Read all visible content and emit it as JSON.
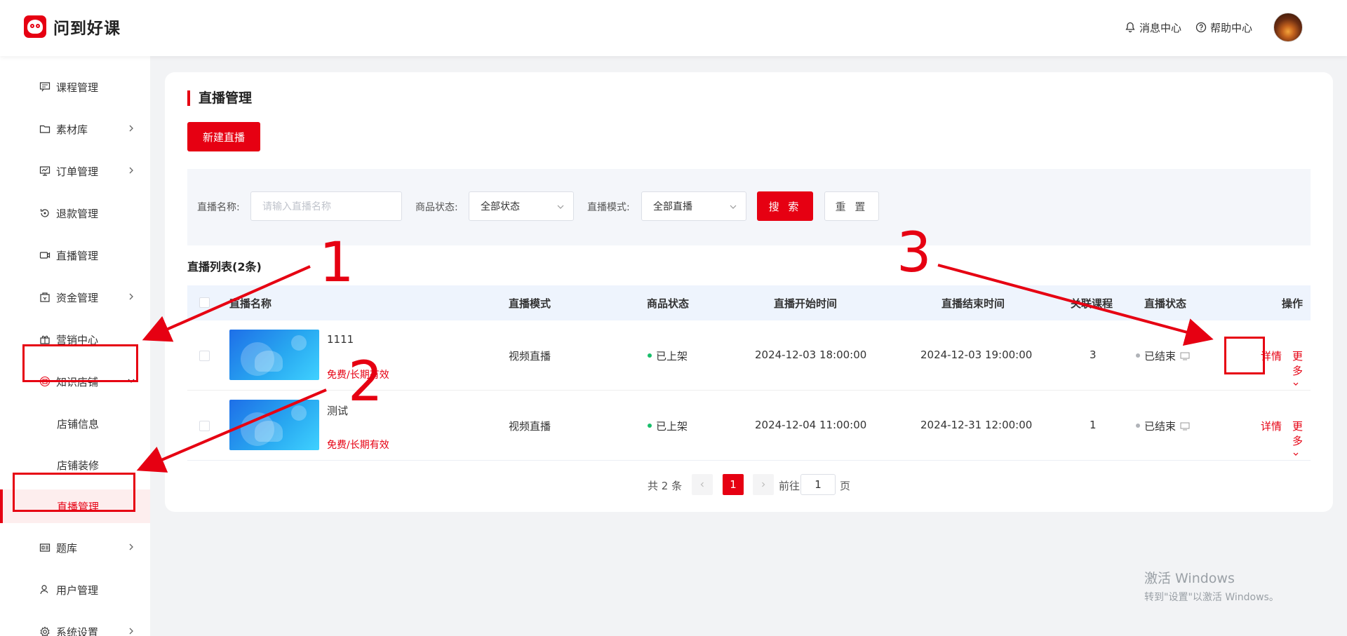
{
  "header": {
    "brand": "问到好课",
    "message_center": "消息中心",
    "help_center": "帮助中心"
  },
  "sidebar": {
    "items": [
      {
        "label": "课程管理",
        "icon": "chat-icon"
      },
      {
        "label": "素材库",
        "icon": "folder-icon"
      },
      {
        "label": "订单管理",
        "icon": "monitor-icon"
      },
      {
        "label": "退款管理",
        "icon": "refund-icon"
      },
      {
        "label": "直播管理",
        "icon": "video-icon"
      },
      {
        "label": "资金管理",
        "icon": "wallet-icon"
      },
      {
        "label": "营销中心",
        "icon": "gift-icon"
      },
      {
        "label": "知识店铺",
        "icon": "shop-icon"
      },
      {
        "label": "题库",
        "icon": "question-bank-icon"
      },
      {
        "label": "用户管理",
        "icon": "user-icon"
      },
      {
        "label": "系统设置",
        "icon": "gear-icon"
      }
    ],
    "submenu": [
      {
        "label": "店铺信息"
      },
      {
        "label": "店铺装修"
      },
      {
        "label": "直播管理"
      }
    ]
  },
  "main": {
    "title": "直播管理",
    "new_button": "新建直播",
    "filter": {
      "name_label": "直播名称:",
      "name_placeholder": "请输入直播名称",
      "status_label": "商品状态:",
      "status_value": "全部状态",
      "mode_label": "直播模式:",
      "mode_value": "全部直播",
      "search_button": "搜 索",
      "reset_button": "重 置"
    },
    "list_title": "直播列表(2条)",
    "columns": [
      "直播名称",
      "直播模式",
      "商品状态",
      "直播开始时间",
      "直播结束时间",
      "关联课程",
      "直播状态",
      "操作"
    ],
    "rows": [
      {
        "name": "1111",
        "price": "免费/长期有效",
        "mode": "视频直播",
        "goods_status": "已上架",
        "start": "2024-12-03 18:00:00",
        "end": "2024-12-03 19:00:00",
        "courses": "3",
        "live_status": "已结束",
        "detail": "详情",
        "more": "更多"
      },
      {
        "name": "测试",
        "price": "免费/长期有效",
        "mode": "视频直播",
        "goods_status": "已上架",
        "start": "2024-12-04 11:00:00",
        "end": "2024-12-31 12:00:00",
        "courses": "1",
        "live_status": "已结束",
        "detail": "详情",
        "more": "更多"
      }
    ],
    "pagination": {
      "total": "共 2 条",
      "current_page": "1",
      "goto_label": "前往",
      "goto_value": "1",
      "page_suffix": "页"
    }
  },
  "annotations": [
    "1",
    "2",
    "3"
  ],
  "watermark": {
    "line1": "激活 Windows",
    "line2": "转到\"设置\"以激活 Windows。"
  },
  "colors": {
    "brand_red": "#e60012",
    "header_bg": "#eef4fd",
    "status_green": "#19be6b",
    "status_gray": "#b0b3b8"
  }
}
